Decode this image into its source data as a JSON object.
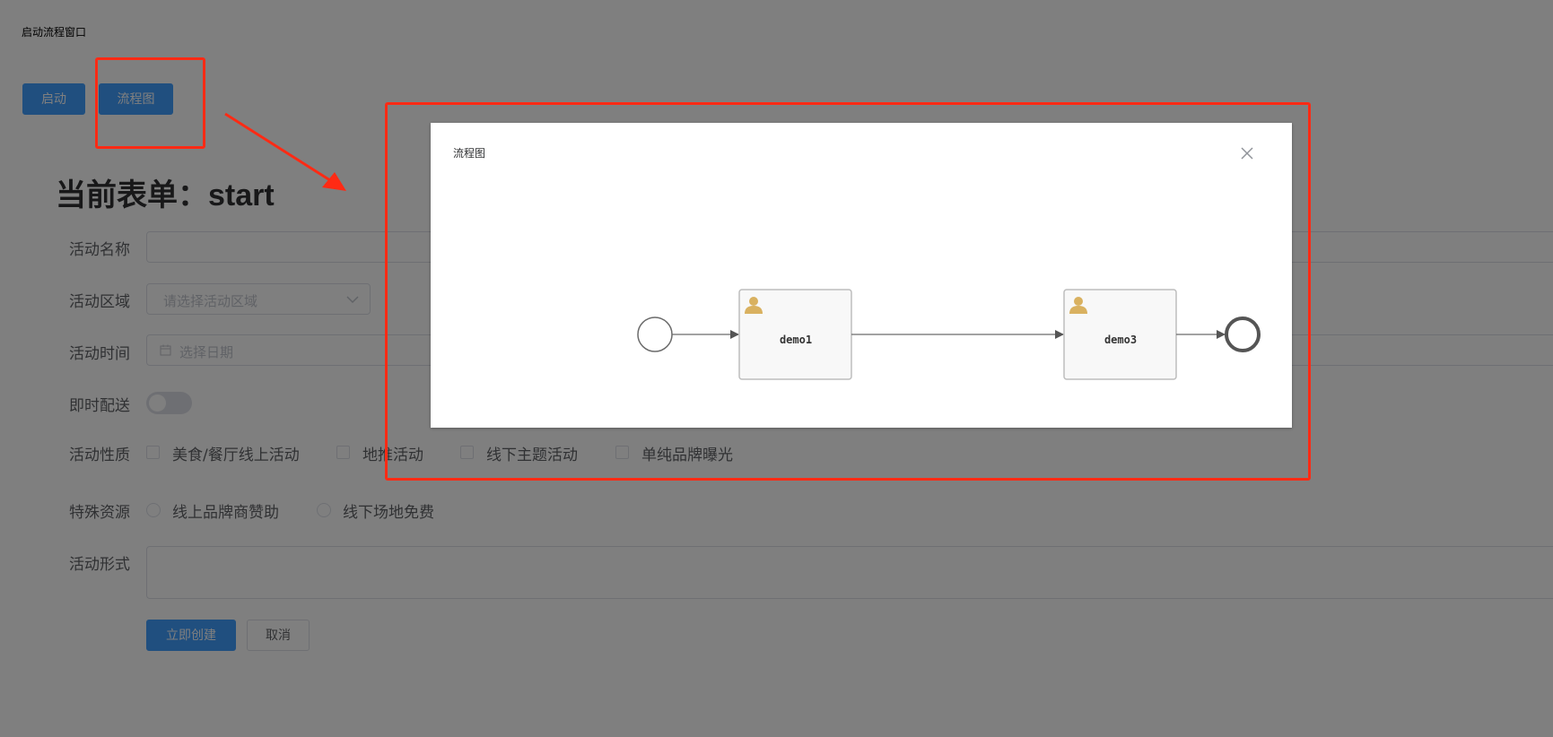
{
  "window": {
    "title": "启动流程窗口"
  },
  "toolbar": {
    "start_label": "启动",
    "flowchart_label": "流程图"
  },
  "form": {
    "heading": "当前表单：start",
    "activity_name": {
      "label": "活动名称",
      "value": ""
    },
    "activity_region": {
      "label": "活动区域",
      "placeholder": "请选择活动区域"
    },
    "activity_time": {
      "label": "活动时间",
      "placeholder": "选择日期"
    },
    "instant_delivery": {
      "label": "即时配送",
      "on": false
    },
    "activity_nature": {
      "label": "活动性质",
      "options": [
        "美食/餐厅线上活动",
        "地推活动",
        "线下主题活动",
        "单纯品牌曝光"
      ]
    },
    "special_resources": {
      "label": "特殊资源",
      "options": [
        "线上品牌商赞助",
        "线下场地免费"
      ]
    },
    "activity_form": {
      "label": "活动形式",
      "value": ""
    },
    "create_label": "立即创建",
    "cancel_label": "取消"
  },
  "dialog": {
    "title": "流程图",
    "diagram": {
      "tasks": [
        {
          "label": "demo1",
          "icon": "user-icon"
        },
        {
          "label": "demo3",
          "icon": "user-icon"
        }
      ]
    }
  },
  "colors": {
    "primary": "#409eff",
    "annotation": "#ff2a14",
    "user_icon": "#d9b160"
  }
}
